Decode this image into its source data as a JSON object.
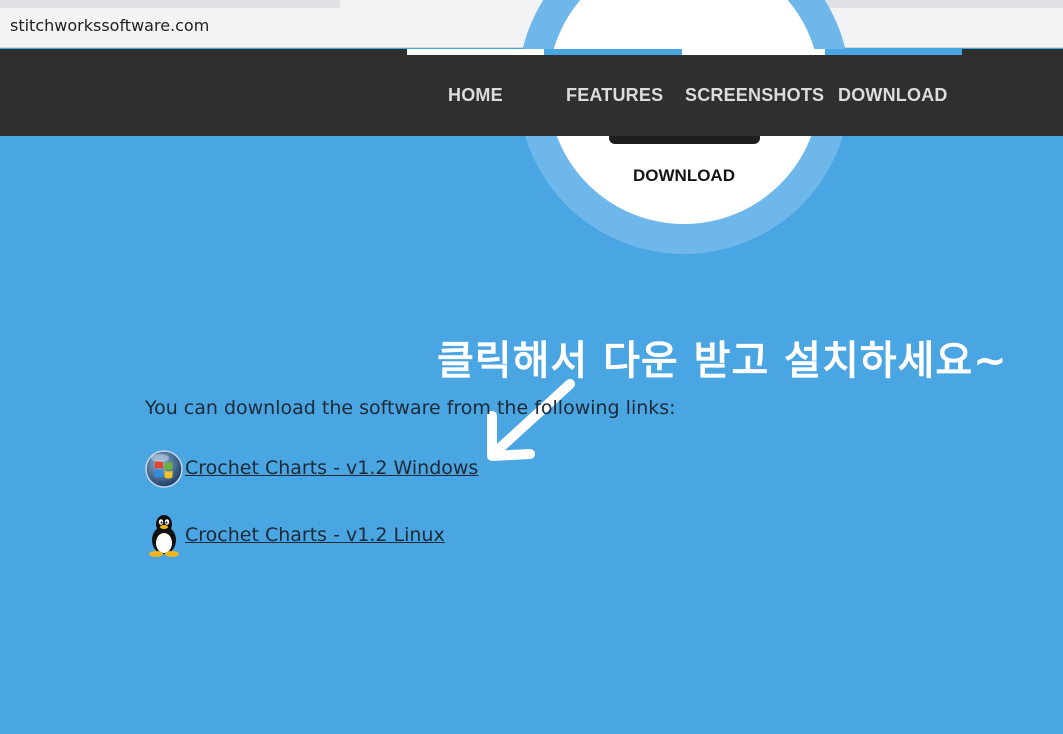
{
  "browser": {
    "url": "stitchworkssoftware.com"
  },
  "nav": {
    "items": [
      {
        "label": "HOME"
      },
      {
        "label": "FEATURES"
      },
      {
        "label": "SCREENSHOTS"
      },
      {
        "label": "DOWNLOAD"
      }
    ],
    "active": "DOWNLOAD"
  },
  "hero": {
    "label": "DOWNLOAD"
  },
  "content": {
    "intro": "You can download the software from the following links:",
    "links": [
      {
        "label": "Crochet Charts - v1.2 Windows",
        "icon": "windows-logo-icon"
      },
      {
        "label": "Crochet Charts - v1.2 Linux",
        "icon": "linux-tux-icon"
      }
    ]
  },
  "annotation": {
    "text": "클릭해서 다운 받고 설치하세요~",
    "arrow_icon": "arrow-pointer-icon"
  },
  "colors": {
    "page_background": "#4aa5e3",
    "navbar": "#2f2f2f",
    "nav_accent": "#4aa5e3",
    "nav_text": "#dcdcdc"
  }
}
